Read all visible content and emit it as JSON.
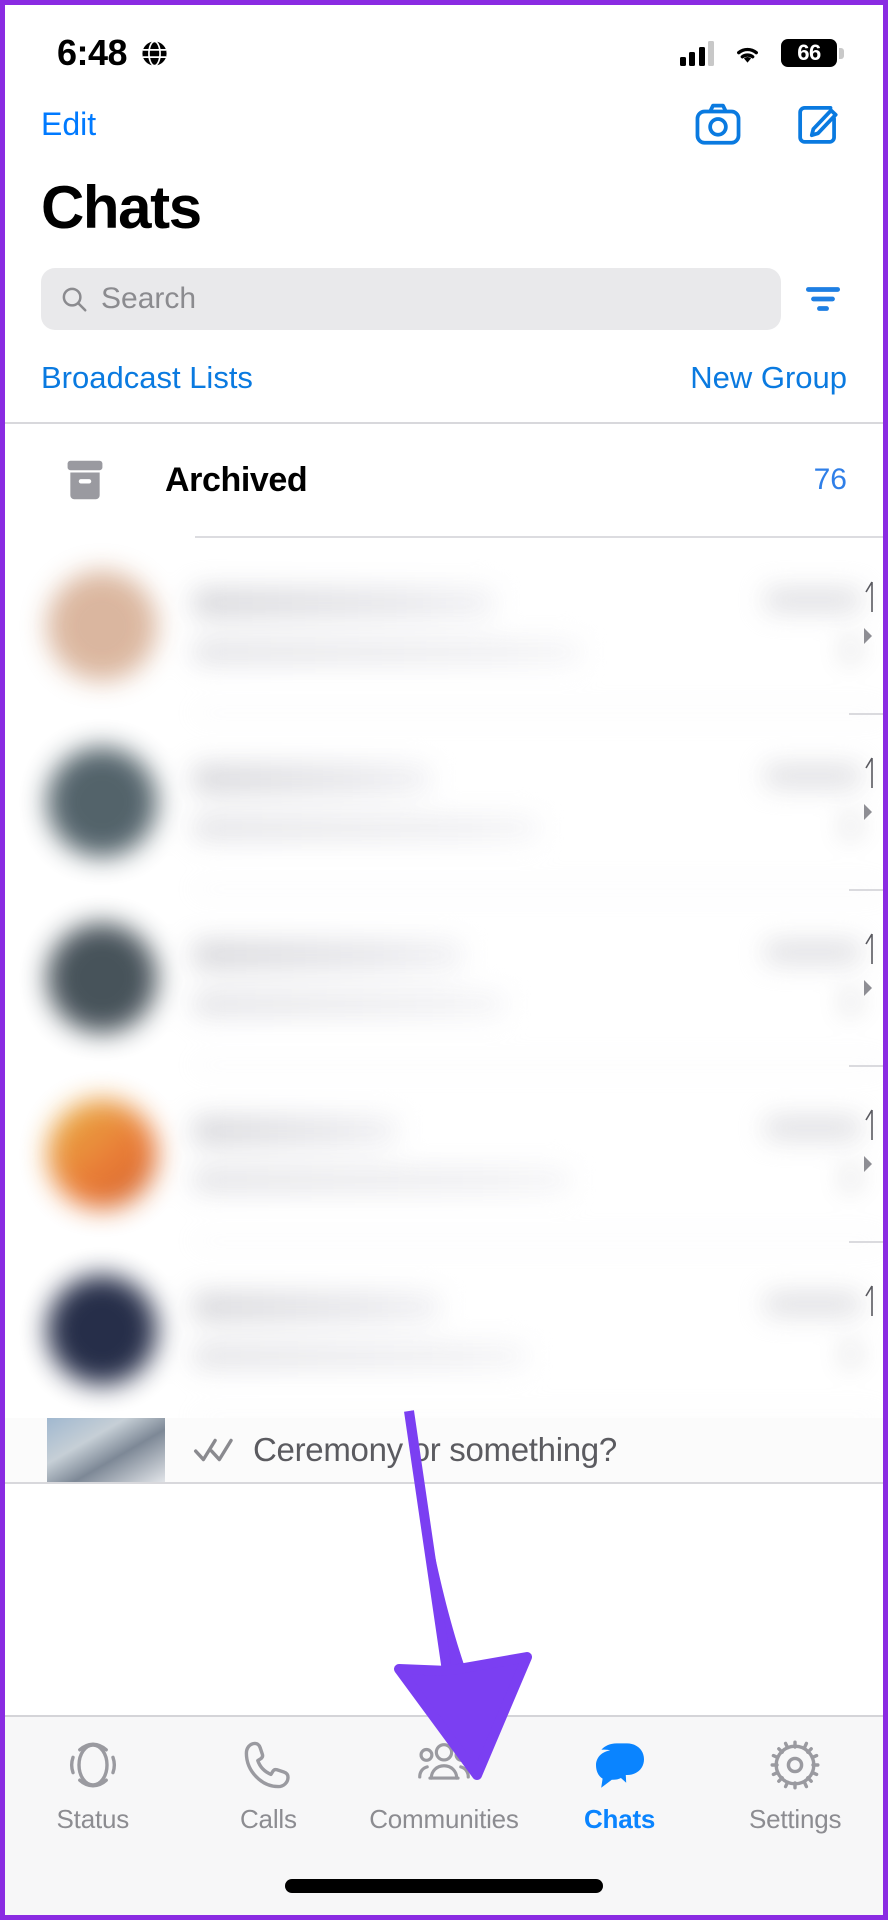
{
  "status_bar": {
    "time": "6:48",
    "globe_icon": "globe-icon",
    "signal_icon": "cellular-signal-icon",
    "wifi_icon": "wifi-icon",
    "battery_level": "66",
    "battery_icon": "battery-icon"
  },
  "nav": {
    "edit_label": "Edit",
    "camera_icon": "camera-icon",
    "compose_icon": "compose-icon"
  },
  "header": {
    "title": "Chats"
  },
  "search": {
    "placeholder": "Search",
    "search_icon": "search-icon",
    "filter_icon": "filter-icon"
  },
  "links": {
    "broadcast_lists": "Broadcast Lists",
    "new_group": "New Group"
  },
  "archived": {
    "icon": "archive-box-icon",
    "label": "Archived",
    "count": "76"
  },
  "chat_list": {
    "blurred_note": "",
    "rows": [
      {
        "avatar_color": "#d9b39a",
        "chevron_icon": "chevron-right-icon"
      },
      {
        "avatar_color": "#4a5b63",
        "chevron_icon": "chevron-right-icon"
      },
      {
        "avatar_color": "#3e4a52",
        "chevron_icon": "chevron-right-icon"
      },
      {
        "avatar_color": "#e08a3c",
        "chevron_icon": "chevron-right-icon"
      },
      {
        "avatar_color": "#1b2340",
        "chevron_icon": "chevron-right-icon"
      }
    ]
  },
  "last_message": {
    "read_receipt_icon": "double-check-icon",
    "text": "Ceremony or something?",
    "thumbnail": "photo-thumbnail"
  },
  "tabs": [
    {
      "label": "Status",
      "icon": "status-rings-icon",
      "active": false
    },
    {
      "label": "Calls",
      "icon": "phone-icon",
      "active": false
    },
    {
      "label": "Communities",
      "icon": "communities-icon",
      "active": false
    },
    {
      "label": "Chats",
      "icon": "chat-bubbles-icon",
      "active": true
    },
    {
      "label": "Settings",
      "icon": "gear-icon",
      "active": false
    }
  ],
  "annotation": {
    "arrow_icon": "down-arrow-annotation",
    "color": "#7B3FF2",
    "points_to": "Communities"
  },
  "colors": {
    "ios_blue": "#007AFF",
    "link_blue": "#0A7AE0",
    "active_tab": "#0A84FF",
    "inactive_tab": "#8C8C91",
    "annotation_purple": "#7B3FF2",
    "frame_purple": "#8A2BE2",
    "search_bg": "#E9E9EB"
  },
  "home_indicator": "home-indicator"
}
